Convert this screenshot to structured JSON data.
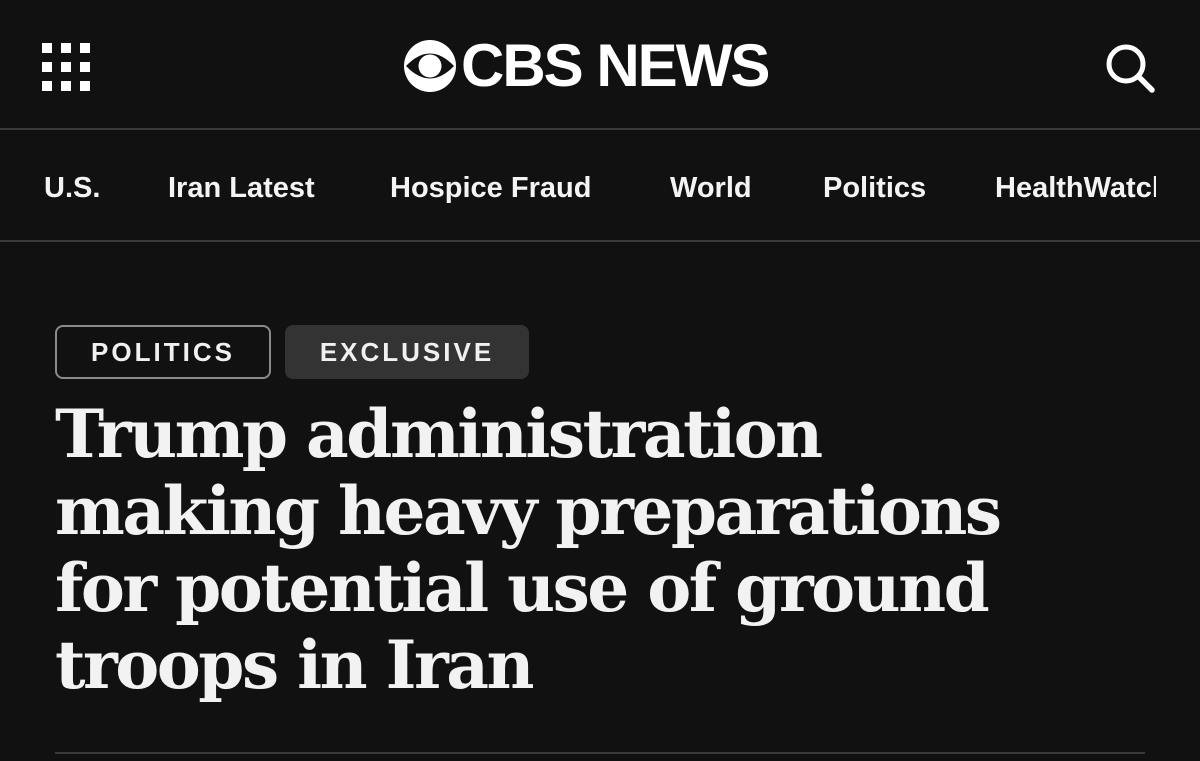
{
  "header": {
    "brand": "CBS NEWS",
    "menu_icon": "grid-menu-icon",
    "brand_icon": "cbs-eye-logo-icon",
    "search_icon": "search-icon"
  },
  "nav": {
    "items": [
      {
        "label": "U.S."
      },
      {
        "label": "Iran Latest"
      },
      {
        "label": "Hospice Fraud"
      },
      {
        "label": "World"
      },
      {
        "label": "Politics"
      },
      {
        "label": "HealthWatch"
      }
    ]
  },
  "article": {
    "tags": [
      {
        "label": "POLITICS"
      },
      {
        "label": "EXCLUSIVE"
      }
    ],
    "headline": "Trump administration making heavy preparations for potential use of ground troops in Iran"
  },
  "colors": {
    "background": "#111111",
    "text": "#f2f2f2",
    "divider": "#3a3a3a",
    "exclusive_tag_bg": "#333333",
    "politics_tag_border": "#8a8a8a"
  }
}
